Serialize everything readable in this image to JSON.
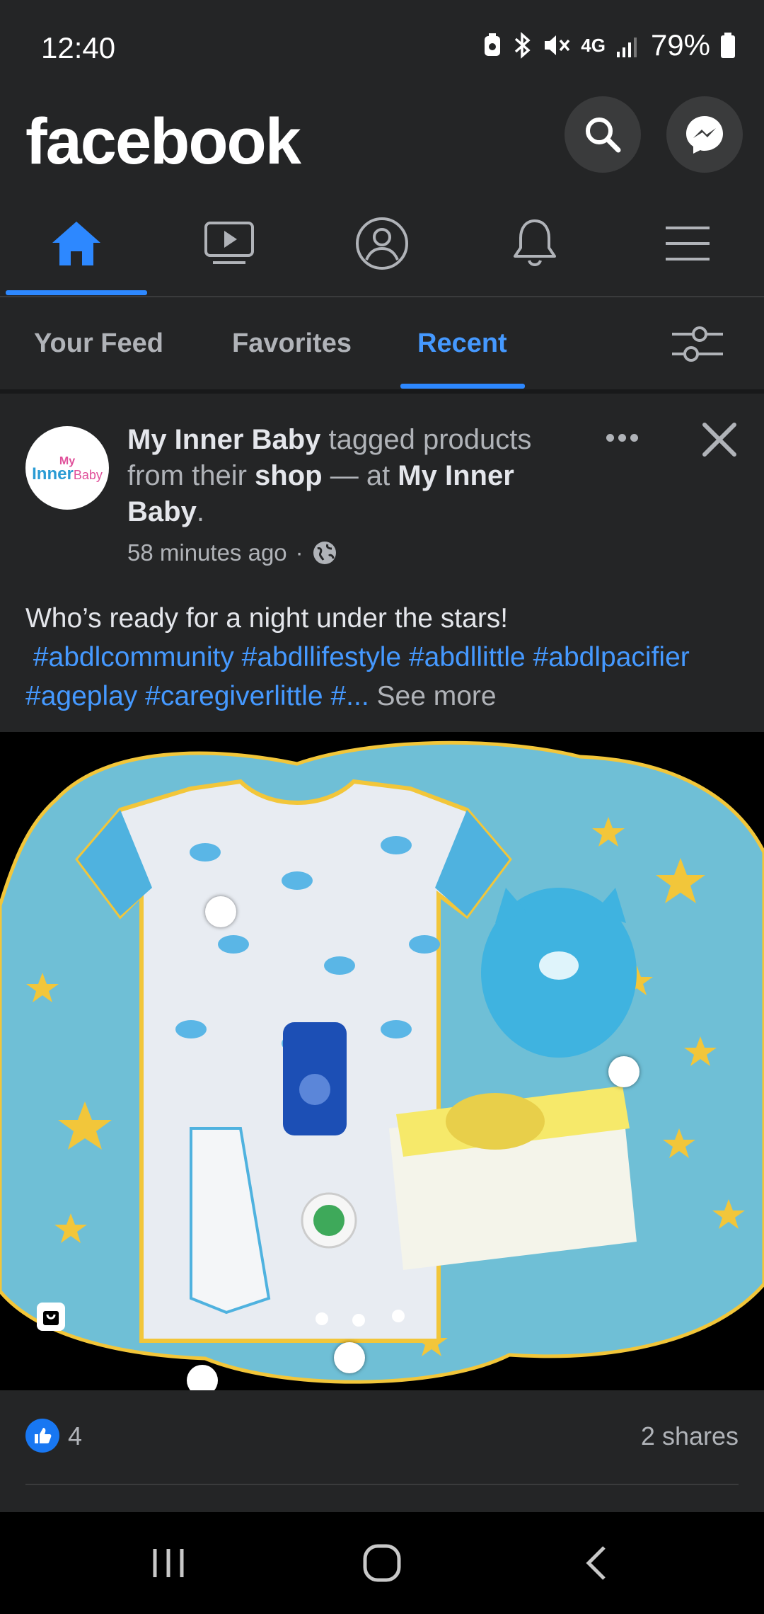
{
  "status_bar": {
    "time": "12:40",
    "network": "4G",
    "battery": "79%"
  },
  "header": {
    "logo": "facebook",
    "search_icon": "search-icon",
    "messenger_icon": "messenger-icon"
  },
  "nav": {
    "items": [
      {
        "name": "home",
        "icon": "home-icon",
        "active": true
      },
      {
        "name": "watch",
        "icon": "video-icon"
      },
      {
        "name": "profile",
        "icon": "profile-icon"
      },
      {
        "name": "notifications",
        "icon": "bell-icon"
      },
      {
        "name": "menu",
        "icon": "hamburger-icon"
      }
    ],
    "accent": "#2d88ff"
  },
  "feed_tabs": {
    "tabs": [
      "Your Feed",
      "Favorites",
      "Recent"
    ],
    "active": "Recent"
  },
  "post": {
    "avatar_text_1": "My",
    "avatar_text_2": "Inner",
    "avatar_text_3": "Baby",
    "author": "My Inner Baby",
    "action_1": " tagged products from their ",
    "shop": "shop",
    "action_2": " — at ",
    "place": "My Inner Baby",
    "period": ".",
    "time": "58 minutes ago",
    "separator": "·",
    "text": "Who’s ready for a night under the stars!",
    "tags": [
      "#abdlcommunity",
      "#abdllifestyle",
      "#abdllittle",
      "#abdlpacifier",
      "#ageplay",
      "#caregiverlittle"
    ],
    "tag_truncated": "#...",
    "see_more": "See more",
    "likes": "4",
    "shares": "2 shares"
  }
}
